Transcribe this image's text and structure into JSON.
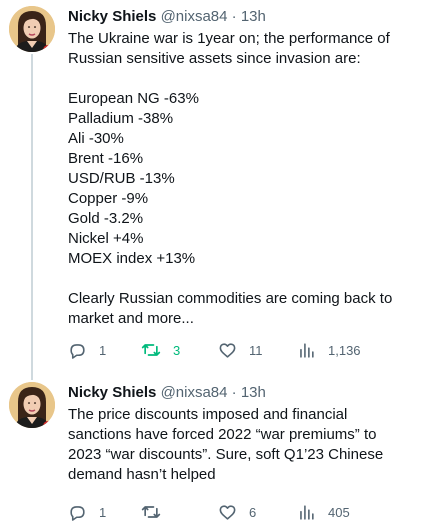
{
  "tweets": [
    {
      "author": {
        "name": "Nicky Shiels",
        "handle": "@nixsa84",
        "separator": "·",
        "time": "13h"
      },
      "lines": [
        "The Ukraine war is 1year on; the performance of",
        "Russian sensitive assets since invasion are:",
        "",
        "European NG -63%",
        "Palladium -38%",
        "Ali -30%",
        "Brent -16%",
        "USD/RUB -13%",
        "Copper -9%",
        "Gold -3.2%",
        "Nickel +4%",
        "MOEX index +13%",
        "",
        "Clearly Russian commodities are coming back to",
        "market and more..."
      ],
      "actions": {
        "replies": "1",
        "retweets": "3",
        "likes": "11",
        "views": "1,136"
      }
    },
    {
      "author": {
        "name": "Nicky Shiels",
        "handle": "@nixsa84",
        "separator": "·",
        "time": "13h"
      },
      "lines": [
        "The price discounts imposed and financial",
        "sanctions have forced 2022 “war premiums” to",
        "2023 “war discounts”. Sure, soft Q1’23 Chinese",
        "demand hasn’t helped"
      ],
      "actions": {
        "replies": "1",
        "retweets": "",
        "likes": "6",
        "views": "405"
      }
    }
  ],
  "colors": {
    "text": "#0f1419",
    "secondary": "#536471",
    "retweet_active": "#00ba7c",
    "thread_line": "#cfd9de"
  },
  "icons": [
    "reply-icon",
    "retweet-icon",
    "like-icon",
    "views-icon"
  ]
}
